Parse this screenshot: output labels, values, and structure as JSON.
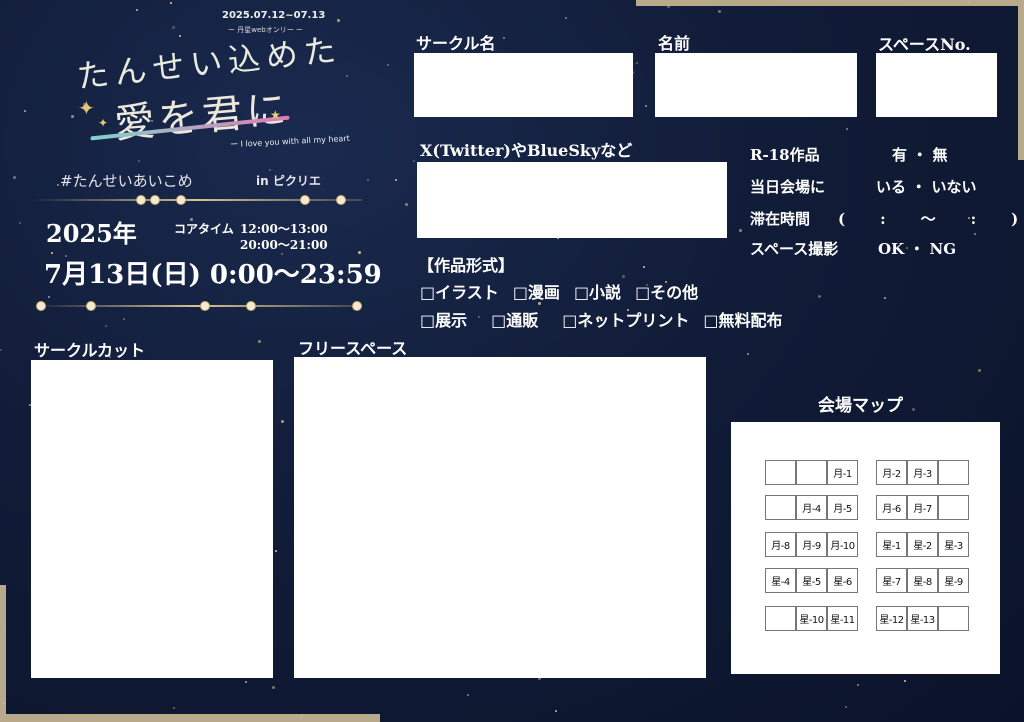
{
  "logo": {
    "dates": "2025.07.12~07.13",
    "subtitle": "ー 丹星webオンリー ー",
    "title_line1": "たんせい込めた",
    "title_line2": "愛を君に",
    "english": "ー I love you with all my heart"
  },
  "event": {
    "hashtag": "#たんせいあいこめ",
    "venue": "in ピクリエ",
    "year": "2025年",
    "core_label": "コアタイム",
    "core_time1": "12:00〜13:00",
    "core_time2": "20:00〜21:00",
    "date": "7月13日(日) 0:00〜23:59"
  },
  "fields": {
    "circle_name": "サークル名",
    "name": "名前",
    "space_no": "スペースNo.",
    "sns": "X(Twitter)やBlueSkyなど",
    "circle_cut": "サークルカット",
    "free_space": "フリースペース",
    "venue_map": "会場マップ"
  },
  "info": [
    {
      "key": "R-18作品",
      "value": "有 ・ 無"
    },
    {
      "key": "当日会場に",
      "value": "いる ・ いない"
    },
    {
      "key": "滞在時間",
      "value": "(　:　〜　:　)"
    },
    {
      "key": "スペース撮影",
      "value": "OK ・ NG"
    }
  ],
  "format": {
    "heading": "【作品形式】",
    "row1": [
      "□イラスト",
      "□漫画",
      "□小説",
      "□その他"
    ],
    "row2": [
      "□展示",
      "□通販",
      "□ネットプリント",
      "□無料配布"
    ]
  },
  "map": {
    "cells": [
      "",
      "",
      "月-1",
      "月-2",
      "月-3",
      "",
      "",
      "月-4",
      "月-5",
      "月-6",
      "月-7",
      "",
      "月-8",
      "月-9",
      "月-10",
      "星-1",
      "星-2",
      "星-3",
      "星-4",
      "星-5",
      "星-6",
      "星-7",
      "星-8",
      "星-9",
      "",
      "星-10",
      "星-11",
      "星-12",
      "星-13",
      ""
    ]
  }
}
